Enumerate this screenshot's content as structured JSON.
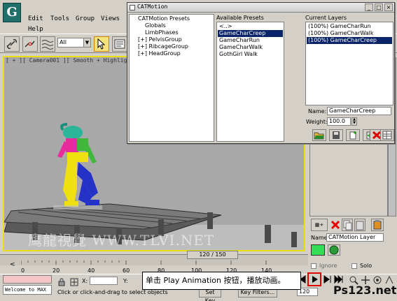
{
  "app": {
    "logo_letter": "G",
    "menu": [
      "Edit",
      "Tools",
      "Group",
      "Views",
      "Help"
    ],
    "selection_filter": "All"
  },
  "viewport": {
    "label": "[ + ][ Camera001 ][ Smooth + Highlights ]",
    "watermark": "鹰龍視覺 WWW.TLVI.NET"
  },
  "cat_dialog": {
    "title": "CATMotion",
    "tree": [
      {
        "label": "CATMotion Presets",
        "depth": 0
      },
      {
        "label": "Globals",
        "depth": 1
      },
      {
        "label": "LimbPhases",
        "depth": 1
      },
      {
        "label": "[+] PelvisGroup",
        "depth": 1
      },
      {
        "label": "[+] RibcageGroup",
        "depth": 1
      },
      {
        "label": "[+] HeadGroup",
        "depth": 1
      }
    ],
    "available_presets_label": "Available Presets",
    "available_presets": [
      "<..>",
      "GameCharCreep",
      "GameCharRun",
      "GameCharWalk",
      "GothGirl Walk"
    ],
    "available_selected_index": 1,
    "current_layers_label": "Current Layers",
    "current_layers": [
      "(100%) GameCharRun",
      "(100%) GameCharWalk",
      "(100%) GameCharCreep"
    ],
    "current_selected_index": 2,
    "name_label": "Name:",
    "name_value": "GameCharCreep",
    "weight_label": "Weight:",
    "weight_value": "100.0"
  },
  "command_panel": {
    "name_label": "Name:",
    "layer_name": "CATMotion Layer",
    "ignore_label": "Ignore",
    "solo_label": "Solo",
    "swatch_color": "#33dd55"
  },
  "timeline": {
    "slider_text": "120 / 150",
    "ruler_ticks": [
      "0",
      "20",
      "40",
      "60",
      "80",
      "100",
      "120",
      "140"
    ],
    "frame_value": "120"
  },
  "status": {
    "welcome": "Welcome to MAX",
    "prompt": "Click or click-and-drag to select objects",
    "x_label": "X:",
    "y_label": "Y:",
    "set_key": "Set Key",
    "key_filters": "Key Filters..."
  },
  "callout": {
    "text": "单击 Play Animation 按钮，播放动画。"
  },
  "watermark_logo": "Ps123.net"
}
